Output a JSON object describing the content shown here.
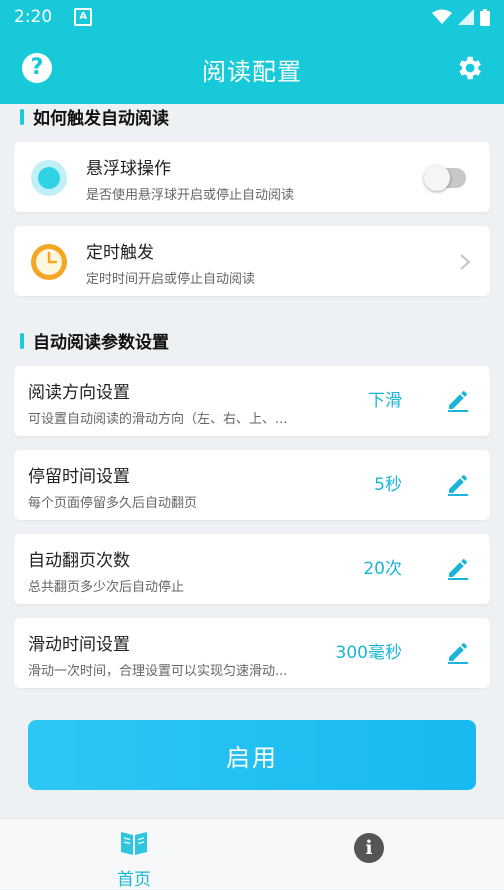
{
  "status_bar": {
    "time": "2:20",
    "notification_badge": "A"
  },
  "app_bar": {
    "title": "阅读配置",
    "help_icon": "help-circle-icon",
    "settings_icon": "gear-icon"
  },
  "trigger_section": {
    "title": "如何触发自动阅读",
    "items": [
      {
        "title": "悬浮球操作",
        "subtitle": "是否使用悬浮球开启或停止自动阅读",
        "icon": "floating-ball-icon",
        "control": "toggle",
        "enabled": false
      },
      {
        "title": "定时触发",
        "subtitle": "定时时间开启或停止自动阅读",
        "icon": "clock-icon",
        "control": "chevron"
      }
    ]
  },
  "params_section": {
    "title": "自动阅读参数设置",
    "items": [
      {
        "title": "阅读方向设置",
        "subtitle": "可设置自动阅读的滑动方向（左、右、上、...",
        "value": "下滑"
      },
      {
        "title": "停留时间设置",
        "subtitle": "每个页面停留多久后自动翻页",
        "value": "5秒"
      },
      {
        "title": "自动翻页次数",
        "subtitle": "总共翻页多少次后自动停止",
        "value": "20次"
      },
      {
        "title": "滑动时间设置",
        "subtitle": "滑动一次时间，合理设置可以实现匀速滑动...",
        "value": "300毫秒"
      }
    ]
  },
  "enable_button": {
    "label": "启用"
  },
  "bottom_nav": {
    "home_label": "首页",
    "home_icon": "book-icon",
    "info_icon": "info-icon"
  },
  "colors": {
    "accent": "#18c9d9",
    "value_text": "#1ab5d8",
    "clock_orange": "#f5a623"
  }
}
